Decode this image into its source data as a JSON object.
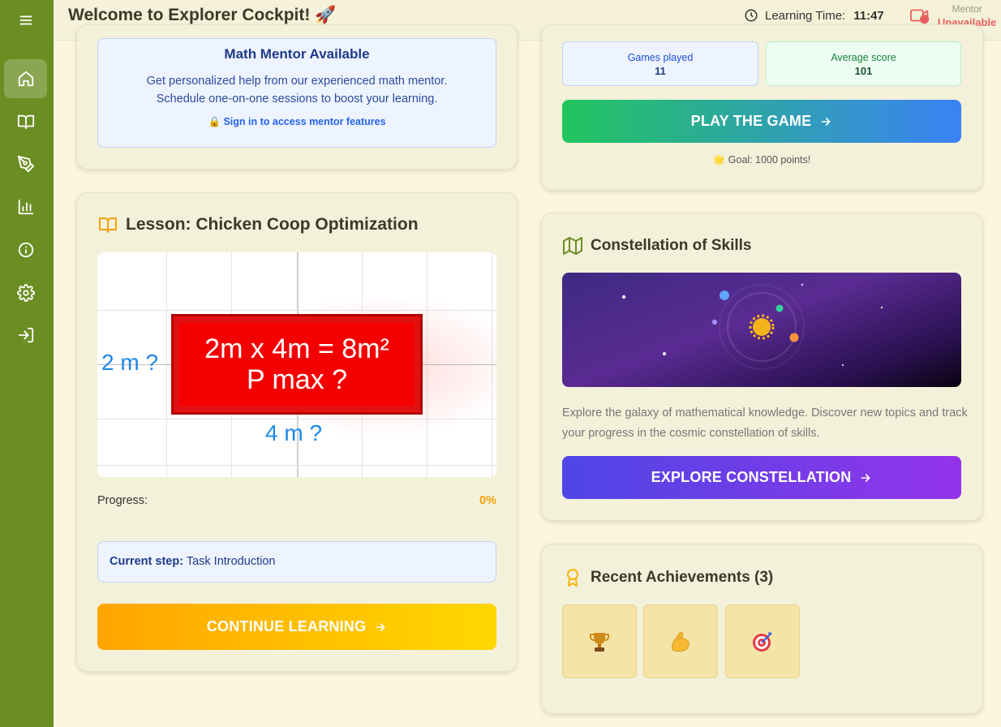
{
  "header": {
    "title": "Welcome to Explorer Cockpit! 🚀",
    "learning_time_label": "Learning Time:",
    "learning_time_value": "11:47",
    "mentor_label": "Mentor",
    "mentor_status": "Unavailable"
  },
  "sidebar": {
    "items": [
      {
        "icon": "menu-icon"
      },
      {
        "icon": "home-icon",
        "active": true
      },
      {
        "icon": "book-icon"
      },
      {
        "icon": "pen-tool-icon"
      },
      {
        "icon": "bar-chart-icon"
      },
      {
        "icon": "info-icon"
      },
      {
        "icon": "settings-icon"
      },
      {
        "icon": "login-icon"
      }
    ]
  },
  "mentor_card": {
    "title": "Math Mentor Available",
    "line1": "Get personalized help from our experienced math mentor.",
    "line2": "Schedule one-on-one sessions to boost your learning.",
    "signin": "🔒 Sign in to access mentor features"
  },
  "lesson": {
    "title": "Lesson: Chicken Coop Optimization",
    "image": {
      "line1": "2m x 4m = 8m²",
      "line2": "P max ?",
      "side_label": "2 m ?",
      "bottom_label": "4 m ?"
    },
    "progress_label": "Progress:",
    "progress_value": "0%",
    "current_step_label": "Current step:",
    "current_step_value": "Task Introduction",
    "continue_label": "CONTINUE LEARNING"
  },
  "game": {
    "games_played_label": "Games played",
    "games_played_value": "11",
    "average_score_label": "Average score",
    "average_score_value": "101",
    "play_label": "PLAY THE GAME",
    "goal": "🌟 Goal: 1000 points!"
  },
  "skills": {
    "title": "Constellation of Skills",
    "description": "Explore the galaxy of mathematical knowledge. Discover new topics and track your progress in the cosmic constellation of skills.",
    "explore_label": "EXPLORE CONSTELLATION"
  },
  "achievements": {
    "title": "Recent Achievements (3)",
    "items": [
      "🏆",
      "💪",
      "🎯"
    ]
  },
  "colors": {
    "sidebar": "#6b8e23",
    "accent_orange": "#f5a00a",
    "play_gradient_start": "#22c55e",
    "play_gradient_end": "#3b82f6",
    "explore_gradient_start": "#4f46e5",
    "explore_gradient_end": "#9333ea"
  }
}
